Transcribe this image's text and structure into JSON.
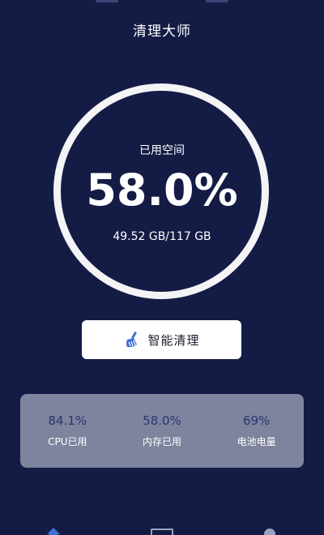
{
  "header": {
    "title": "清理大师"
  },
  "storage": {
    "label": "已用空间",
    "percent": "58.0%",
    "detail": "49.52 GB/117 GB"
  },
  "action": {
    "clean_label": "智能清理",
    "icon": "broom-icon"
  },
  "stats": [
    {
      "value": "84.1%",
      "label": "CPU已用"
    },
    {
      "value": "58.0%",
      "label": "内存已用"
    },
    {
      "value": "69%",
      "label": "电池电量"
    }
  ],
  "nav": [
    {
      "icon": "home-icon"
    },
    {
      "icon": "toolbox-icon"
    },
    {
      "icon": "user-icon"
    }
  ],
  "colors": {
    "background": "#141c45",
    "ring": "#f4f4f6",
    "card": "#7e839e",
    "stat_value": "#2c3570",
    "accent_blue": "#3f6fd6"
  }
}
